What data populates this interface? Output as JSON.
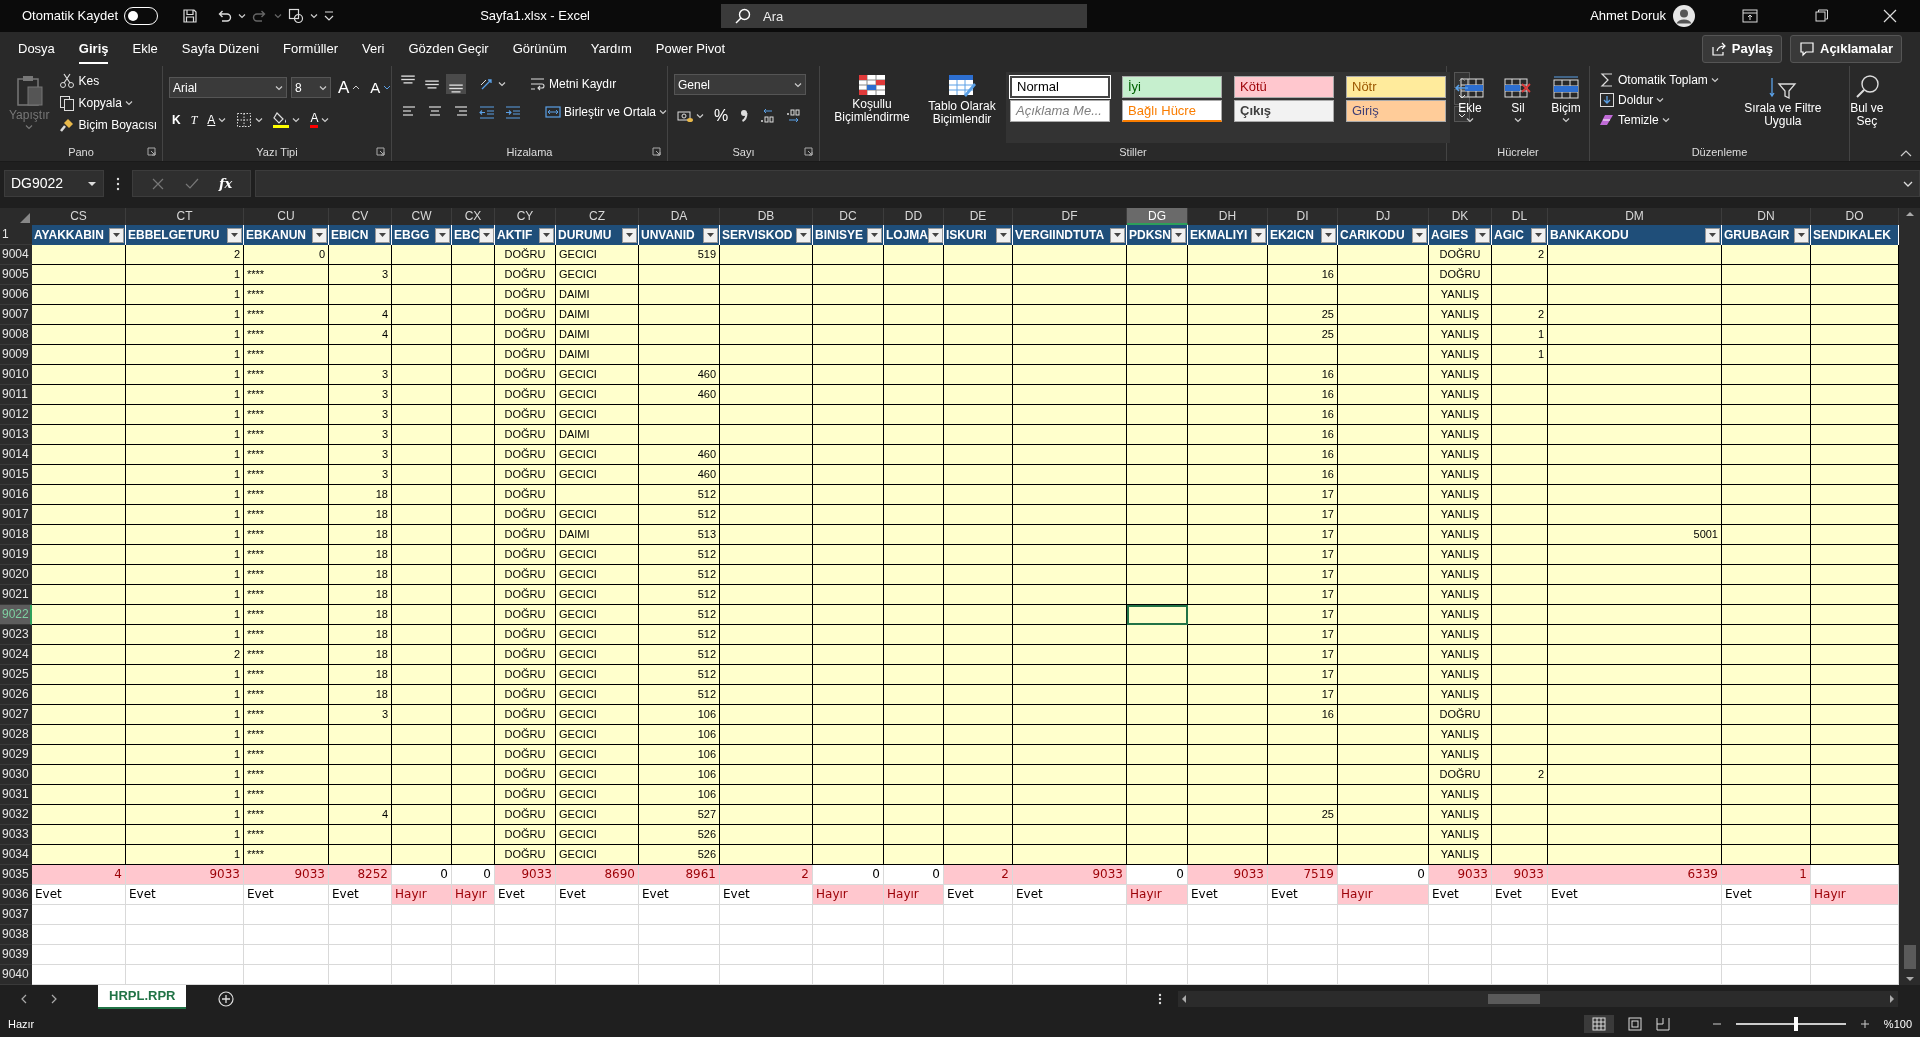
{
  "title_bar": {
    "autosave_label": "Otomatik Kaydet",
    "autosave_on": false,
    "file_title": "Sayfa1.xlsx  -  Excel",
    "search": {
      "placeholder": "Ara"
    },
    "user_name": "Ahmet Doruk"
  },
  "menu_tabs": [
    {
      "label": "Dosya",
      "selected": false
    },
    {
      "label": "Giriş",
      "selected": true
    },
    {
      "label": "Ekle",
      "selected": false
    },
    {
      "label": "Sayfa Düzeni",
      "selected": false
    },
    {
      "label": "Formüller",
      "selected": false
    },
    {
      "label": "Veri",
      "selected": false
    },
    {
      "label": "Gözden Geçir",
      "selected": false
    },
    {
      "label": "Görünüm",
      "selected": false
    },
    {
      "label": "Yardım",
      "selected": false
    },
    {
      "label": "Power Pivot",
      "selected": false
    }
  ],
  "share_buttons": [
    "Paylaş",
    "Açıklamalar"
  ],
  "ribbon": {
    "clipboard": {
      "label": "Pano",
      "paste": {
        "label": "Yapıştır",
        "disabled": true
      },
      "items": [
        "Kes",
        "Kopyala",
        "Biçim Boyacısı"
      ]
    },
    "font": {
      "label": "Yazı Tipi",
      "font_name": "Arial",
      "font_size": "8",
      "grow": "A",
      "shrink": "A",
      "bold": "K",
      "italic": "T",
      "underline": "A",
      "font_color": "A"
    },
    "alignment": {
      "label": "Hizalama",
      "vertical_align": [
        {
          "selected": false
        },
        {
          "selected": false
        },
        {
          "selected": true
        }
      ],
      "wrap_text": "Metni Kaydır",
      "merge_center": "Birleştir ve Ortala"
    },
    "number": {
      "label": "Sayı",
      "format": "Genel",
      "percent": "%"
    },
    "styles": {
      "label": "Stiller",
      "conditional": "Koşullu Biçimlendirme",
      "format_table": "Tablo Olarak Biçimlendir",
      "cell_styles": [
        {
          "label": "Normal",
          "kind": "normal",
          "color": "#ffffff"
        },
        {
          "label": "İyi",
          "kind": "good",
          "color": "#c6efce"
        },
        {
          "label": "Kötü",
          "kind": "bad",
          "color": "#ffc7ce"
        },
        {
          "label": "Nötr",
          "kind": "neutral",
          "color": "#ffeb9c"
        },
        {
          "label": "Açıklama Me...",
          "kind": "explanatory",
          "color": "#ffffff"
        },
        {
          "label": "Bağlı Hücre",
          "kind": "linked",
          "color": "#ffffff"
        },
        {
          "label": "Çıkış",
          "kind": "output",
          "color": "#f2f2f2"
        },
        {
          "label": "Giriş",
          "kind": "input",
          "color": "#ffcc99"
        }
      ]
    },
    "cells": {
      "label": "Hücreler",
      "buttons": [
        "Ekle",
        "Sil",
        "Biçim"
      ]
    },
    "editing": {
      "label": "Düzenleme",
      "autosum": "Otomatik Toplam",
      "fill": "Doldur",
      "clear": "Temizle",
      "sort_filter": "Sırala ve Filtre Uygula",
      "find_select": "Bul ve Seç"
    }
  },
  "formula_bar": {
    "name_box": "DG9022",
    "fx": "fx"
  },
  "sheet": {
    "header_row": "1",
    "columns": [
      {
        "letter": "CS",
        "header": "AYAKKABIN",
        "selected": false,
        "filter": true
      },
      {
        "letter": "CT",
        "header": "EBBELGETURU",
        "kind": "number",
        "selected": false,
        "filter": true
      },
      {
        "letter": "CU",
        "header": "EBKANUN",
        "kind": "text",
        "selected": false,
        "filter": true
      },
      {
        "letter": "CV",
        "header": "EBICN",
        "kind": "number",
        "selected": false,
        "filter": true
      },
      {
        "letter": "CW",
        "header": "EBGG",
        "selected": false,
        "filter": true
      },
      {
        "letter": "CX",
        "header": "EBC",
        "selected": false,
        "filter": true
      },
      {
        "letter": "CY",
        "header": "AKTIF",
        "kind": "boolean",
        "selected": false,
        "filter": true
      },
      {
        "letter": "CZ",
        "header": "DURUMU",
        "kind": "text",
        "selected": false,
        "filter": true
      },
      {
        "letter": "DA",
        "header": "UNVANID",
        "kind": "number",
        "selected": false,
        "filter": true
      },
      {
        "letter": "DB",
        "header": "SERVISKOD",
        "selected": false,
        "filter": true
      },
      {
        "letter": "DC",
        "header": "BINISYE",
        "selected": false,
        "filter": true
      },
      {
        "letter": "DD",
        "header": "LOJMA",
        "selected": false,
        "filter": true
      },
      {
        "letter": "DE",
        "header": "ISKURI",
        "selected": false,
        "filter": true
      },
      {
        "letter": "DF",
        "header": "VERGIINDTUTA",
        "selected": false,
        "filter": true
      },
      {
        "letter": "DG",
        "header": "PDKSN",
        "selected": true,
        "filter": true
      },
      {
        "letter": "DH",
        "header": "EKMALIYI",
        "selected": false,
        "filter": true
      },
      {
        "letter": "DI",
        "header": "EK2ICN",
        "kind": "number",
        "selected": false,
        "filter": true
      },
      {
        "letter": "DJ",
        "header": "CARIKODU",
        "selected": false,
        "filter": true
      },
      {
        "letter": "DK",
        "header": "AGIES",
        "kind": "boolean",
        "selected": false,
        "filter": true
      },
      {
        "letter": "DL",
        "header": "AGIC",
        "kind": "number",
        "selected": false,
        "filter": true
      },
      {
        "letter": "DM",
        "header": "BANKAKODU",
        "kind": "number",
        "selected": false,
        "filter": true
      },
      {
        "letter": "DN",
        "header": "GRUBAGIR",
        "selected": false,
        "filter": true
      },
      {
        "letter": "DO",
        "header": "SENDIKALEK",
        "selected": false,
        "filter": false
      }
    ],
    "rows": [
      {
        "row": "9004",
        "selected": false,
        "cells": {
          "CT": "2",
          "CU": {
            "value": "0",
            "kind": "number"
          },
          "CY": "DOĞRU",
          "CZ": "GECICI",
          "DA": "519",
          "DK": "DOĞRU",
          "DL": "2"
        }
      },
      {
        "row": "9005",
        "selected": false,
        "cells": {
          "CT": "1",
          "CU": "****",
          "CV": "3",
          "CY": "DOĞRU",
          "CZ": "GECICI",
          "DI": "16",
          "DK": "DOĞRU"
        }
      },
      {
        "row": "9006",
        "selected": false,
        "cells": {
          "CT": "1",
          "CU": "****",
          "CY": "DOĞRU",
          "CZ": "DAIMI",
          "DK": "YANLIŞ"
        }
      },
      {
        "row": "9007",
        "selected": false,
        "cells": {
          "CT": "1",
          "CU": "****",
          "CV": "4",
          "CY": "DOĞRU",
          "CZ": "DAIMI",
          "DI": "25",
          "DK": "YANLIŞ",
          "DL": "2"
        }
      },
      {
        "row": "9008",
        "selected": false,
        "cells": {
          "CT": "1",
          "CU": "****",
          "CV": "4",
          "CY": "DOĞRU",
          "CZ": "DAIMI",
          "DI": "25",
          "DK": "YANLIŞ",
          "DL": "1"
        }
      },
      {
        "row": "9009",
        "selected": false,
        "cells": {
          "CT": "1",
          "CU": "****",
          "CY": "DOĞRU",
          "CZ": "DAIMI",
          "DK": "YANLIŞ",
          "DL": "1"
        }
      },
      {
        "row": "9010",
        "selected": false,
        "cells": {
          "CT": "1",
          "CU": "****",
          "CV": "3",
          "CY": "DOĞRU",
          "CZ": "GECICI",
          "DA": "460",
          "DI": "16",
          "DK": "YANLIŞ"
        }
      },
      {
        "row": "9011",
        "selected": false,
        "cells": {
          "CT": "1",
          "CU": "****",
          "CV": "3",
          "CY": "DOĞRU",
          "CZ": "GECICI",
          "DA": "460",
          "DI": "16",
          "DK": "YANLIŞ"
        }
      },
      {
        "row": "9012",
        "selected": false,
        "cells": {
          "CT": "1",
          "CU": "****",
          "CV": "3",
          "CY": "DOĞRU",
          "CZ": "GECICI",
          "DI": "16",
          "DK": "YANLIŞ"
        }
      },
      {
        "row": "9013",
        "selected": false,
        "cells": {
          "CT": "1",
          "CU": "****",
          "CV": "3",
          "CY": "DOĞRU",
          "CZ": "DAIMI",
          "DI": "16",
          "DK": "YANLIŞ"
        }
      },
      {
        "row": "9014",
        "selected": false,
        "cells": {
          "CT": "1",
          "CU": "****",
          "CV": "3",
          "CY": "DOĞRU",
          "CZ": "GECICI",
          "DA": "460",
          "DI": "16",
          "DK": "YANLIŞ"
        }
      },
      {
        "row": "9015",
        "selected": false,
        "cells": {
          "CT": "1",
          "CU": "****",
          "CV": "3",
          "CY": "DOĞRU",
          "CZ": "GECICI",
          "DA": "460",
          "DI": "16",
          "DK": "YANLIŞ"
        }
      },
      {
        "row": "9016",
        "selected": false,
        "cells": {
          "CT": "1",
          "CU": "****",
          "CV": "18",
          "CY": "DOĞRU",
          "DA": "512",
          "DI": "17",
          "DK": "YANLIŞ"
        }
      },
      {
        "row": "9017",
        "selected": false,
        "cells": {
          "CT": "1",
          "CU": "****",
          "CV": "18",
          "CY": "DOĞRU",
          "CZ": "GECICI",
          "DA": "512",
          "DI": "17",
          "DK": "YANLIŞ"
        }
      },
      {
        "row": "9018",
        "selected": false,
        "cells": {
          "CT": "1",
          "CU": "****",
          "CV": "18",
          "CY": "DOĞRU",
          "CZ": "DAIMI",
          "DA": "513",
          "DI": "17",
          "DK": "YANLIŞ",
          "DM": "5001"
        }
      },
      {
        "row": "9019",
        "selected": false,
        "cells": {
          "CT": "1",
          "CU": "****",
          "CV": "18",
          "CY": "DOĞRU",
          "CZ": "GECICI",
          "DA": "512",
          "DI": "17",
          "DK": "YANLIŞ"
        }
      },
      {
        "row": "9020",
        "selected": false,
        "cells": {
          "CT": "1",
          "CU": "****",
          "CV": "18",
          "CY": "DOĞRU",
          "CZ": "GECICI",
          "DA": "512",
          "DI": "17",
          "DK": "YANLIŞ"
        }
      },
      {
        "row": "9021",
        "selected": false,
        "cells": {
          "CT": "1",
          "CU": "****",
          "CV": "18",
          "CY": "DOĞRU",
          "CZ": "GECICI",
          "DA": "512",
          "DI": "17",
          "DK": "YANLIŞ"
        }
      },
      {
        "row": "9022",
        "selected": true,
        "cells": {
          "CT": "1",
          "CU": "****",
          "CV": "18",
          "CY": "DOĞRU",
          "CZ": "GECICI",
          "DA": "512",
          "DI": "17",
          "DK": "YANLIŞ"
        }
      },
      {
        "row": "9023",
        "selected": false,
        "cells": {
          "CT": "1",
          "CU": "****",
          "CV": "18",
          "CY": "DOĞRU",
          "CZ": "GECICI",
          "DA": "512",
          "DI": "17",
          "DK": "YANLIŞ"
        }
      },
      {
        "row": "9024",
        "selected": false,
        "cells": {
          "CT": "2",
          "CU": "****",
          "CV": "18",
          "CY": "DOĞRU",
          "CZ": "GECICI",
          "DA": "512",
          "DI": "17",
          "DK": "YANLIŞ"
        }
      },
      {
        "row": "9025",
        "selected": false,
        "cells": {
          "CT": "1",
          "CU": "****",
          "CV": "18",
          "CY": "DOĞRU",
          "CZ": "GECICI",
          "DA": "512",
          "DI": "17",
          "DK": "YANLIŞ"
        }
      },
      {
        "row": "9026",
        "selected": false,
        "cells": {
          "CT": "1",
          "CU": "****",
          "CV": "18",
          "CY": "DOĞRU",
          "CZ": "GECICI",
          "DA": "512",
          "DI": "17",
          "DK": "YANLIŞ"
        }
      },
      {
        "row": "9027",
        "selected": false,
        "cells": {
          "CT": "1",
          "CU": "****",
          "CV": "3",
          "CY": "DOĞRU",
          "CZ": "GECICI",
          "DA": "106",
          "DI": "16",
          "DK": "DOĞRU"
        }
      },
      {
        "row": "9028",
        "selected": false,
        "cells": {
          "CT": "1",
          "CU": "****",
          "CY": "DOĞRU",
          "CZ": "GECICI",
          "DA": "106",
          "DK": "YANLIŞ"
        }
      },
      {
        "row": "9029",
        "selected": false,
        "cells": {
          "CT": "1",
          "CU": "****",
          "CY": "DOĞRU",
          "CZ": "GECICI",
          "DA": "106",
          "DK": "YANLIŞ"
        }
      },
      {
        "row": "9030",
        "selected": false,
        "cells": {
          "CT": "1",
          "CU": "****",
          "CY": "DOĞRU",
          "CZ": "GECICI",
          "DA": "106",
          "DK": "DOĞRU",
          "DL": "2"
        }
      },
      {
        "row": "9031",
        "selected": false,
        "cells": {
          "CT": "1",
          "CU": "****",
          "CY": "DOĞRU",
          "CZ": "GECICI",
          "DA": "106",
          "DK": "YANLIŞ"
        }
      },
      {
        "row": "9032",
        "selected": false,
        "cells": {
          "CT": "1",
          "CU": "****",
          "CV": "4",
          "CY": "DOĞRU",
          "CZ": "GECICI",
          "DA": "527",
          "DI": "25",
          "DK": "YANLIŞ"
        }
      },
      {
        "row": "9033",
        "selected": false,
        "cells": {
          "CT": "1",
          "CU": "****",
          "CY": "DOĞRU",
          "CZ": "GECICI",
          "DA": "526",
          "DK": "YANLIŞ"
        }
      },
      {
        "row": "9034",
        "selected": false,
        "cells": {
          "CT": "1",
          "CU": "****",
          "CY": "DOĞRU",
          "CZ": "GECICI",
          "DA": "526",
          "DK": "YANLIŞ"
        }
      }
    ],
    "summary_rows": [
      {
        "row": "9035",
        "kind": "totals",
        "cells": {
          "CS": {
            "value": "4",
            "flagged": true
          },
          "CT": {
            "value": "9033",
            "flagged": true
          },
          "CU": {
            "value": "9033",
            "flagged": true
          },
          "CV": {
            "value": "8252",
            "flagged": true
          },
          "CW": {
            "value": "0",
            "flagged": false
          },
          "CX": {
            "value": "0",
            "flagged": false
          },
          "CY": {
            "value": "9033",
            "flagged": true
          },
          "CZ": {
            "value": "8690",
            "flagged": true
          },
          "DA": {
            "value": "8961",
            "flagged": true
          },
          "DB": {
            "value": "2",
            "flagged": true
          },
          "DC": {
            "value": "0",
            "flagged": false
          },
          "DD": {
            "value": "0",
            "flagged": false
          },
          "DE": {
            "value": "2",
            "flagged": true
          },
          "DF": {
            "value": "9033",
            "flagged": true
          },
          "DG": {
            "value": "0",
            "flagged": false
          },
          "DH": {
            "value": "9033",
            "flagged": true
          },
          "DI": {
            "value": "7519",
            "flagged": true
          },
          "DJ": {
            "value": "0",
            "flagged": false
          },
          "DK": {
            "value": "9033",
            "flagged": true
          },
          "DL": {
            "value": "9033",
            "flagged": true
          },
          "DM": {
            "value": "6339",
            "flagged": true
          },
          "DN": {
            "value": "1",
            "flagged": true
          }
        }
      },
      {
        "row": "9036",
        "kind": "answers",
        "cells": {
          "CS": {
            "value": "Evet",
            "flagged": false
          },
          "CT": {
            "value": "Evet",
            "flagged": false
          },
          "CU": {
            "value": "Evet",
            "flagged": false
          },
          "CV": {
            "value": "Evet",
            "flagged": false
          },
          "CW": {
            "value": "Hayır",
            "flagged": true
          },
          "CX": {
            "value": "Hayır",
            "flagged": true
          },
          "CY": {
            "value": "Evet",
            "flagged": false
          },
          "CZ": {
            "value": "Evet",
            "flagged": false
          },
          "DA": {
            "value": "Evet",
            "flagged": false
          },
          "DB": {
            "value": "Evet",
            "flagged": false
          },
          "DC": {
            "value": "Hayır",
            "flagged": true
          },
          "DD": {
            "value": "Hayır",
            "flagged": true
          },
          "DE": {
            "value": "Evet",
            "flagged": false
          },
          "DF": {
            "value": "Evet",
            "flagged": false
          },
          "DG": {
            "value": "Hayır",
            "flagged": true
          },
          "DH": {
            "value": "Evet",
            "flagged": false
          },
          "DI": {
            "value": "Evet",
            "flagged": false
          },
          "DJ": {
            "value": "Hayır",
            "flagged": true
          },
          "DK": {
            "value": "Evet",
            "flagged": false
          },
          "DL": {
            "value": "Evet",
            "flagged": false
          },
          "DM": {
            "value": "Evet",
            "flagged": false
          },
          "DN": {
            "value": "Evet",
            "flagged": false
          },
          "DO": {
            "value": "Hayır",
            "flagged": true
          }
        }
      }
    ],
    "empty_rows": [
      "9037",
      "9038",
      "9039",
      "9040"
    ]
  },
  "sheet_tabs": [
    {
      "label": "HRPL.RPR",
      "selected": true
    }
  ],
  "status_bar": {
    "status": "Hazır",
    "zoom": "%100",
    "zoom_slider": {
      "level": 0.55
    }
  }
}
